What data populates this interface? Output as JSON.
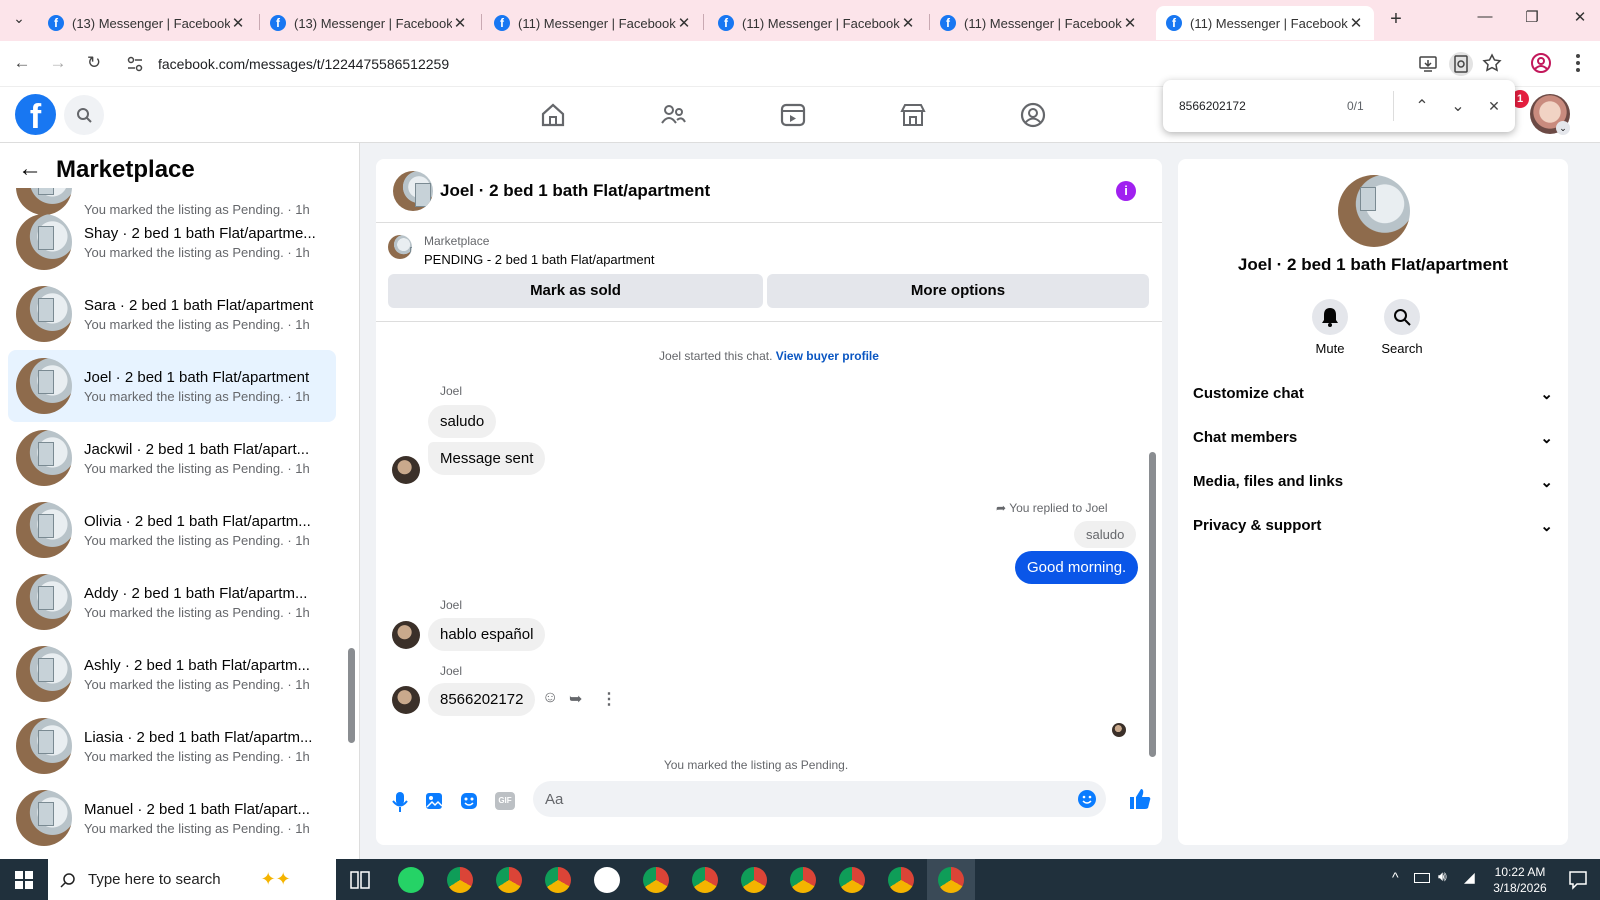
{
  "browser": {
    "tabs": [
      {
        "title": "(13) Messenger | Facebook",
        "close": "✕"
      },
      {
        "title": "(13) Messenger | Facebook",
        "close": "✕"
      },
      {
        "title": "(11) Messenger | Facebook",
        "close": "✕"
      },
      {
        "title": "(11) Messenger | Facebook",
        "close": "✕"
      },
      {
        "title": "(11) Messenger | Facebook",
        "close": "✕"
      },
      {
        "title": "(11) Messenger | Facebook",
        "close": "✕"
      }
    ],
    "favicon": "f",
    "new_tab": "+",
    "tab_menu": "⌄",
    "url": "facebook.com/messages/t/1224475586512259",
    "window": {
      "minimize": "—",
      "restore": "❐",
      "close": "✕"
    },
    "nav": {
      "back": "←",
      "forward": "→",
      "reload": "↻"
    },
    "find": {
      "query": "8566202172",
      "count": "0/1",
      "up": "⌃",
      "down": "⌄",
      "close": "✕"
    },
    "accent": "#1877f2",
    "tab_bg": "#fce4ea"
  },
  "fb_header": {
    "logo": "f",
    "notification_badge": "1",
    "icons": [
      "home-icon",
      "friends-icon",
      "video-icon",
      "marketplace-icon",
      "gaming-icon",
      "search-icon"
    ]
  },
  "sidebar": {
    "back": "←",
    "title": "Marketplace",
    "partial_item_sub": "You marked the listing as Pending. · 1h",
    "items": [
      {
        "title": "Shay · 2 bed 1 bath Flat/apartme...",
        "sub": "You marked the listing as Pending. · 1h"
      },
      {
        "title": "Sara · 2 bed 1 bath Flat/apartment",
        "sub": "You marked the listing as Pending. · 1h"
      },
      {
        "title": "Joel · 2 bed 1 bath Flat/apartment",
        "sub": "You marked the listing as Pending. · 1h"
      },
      {
        "title": "Jackwil · 2 bed 1 bath Flat/apart...",
        "sub": "You marked the listing as Pending. · 1h"
      },
      {
        "title": "Olivia · 2 bed 1 bath Flat/apartm...",
        "sub": "You marked the listing as Pending. · 1h"
      },
      {
        "title": "Addy · 2 bed 1 bath Flat/apartm...",
        "sub": "You marked the listing as Pending. · 1h"
      },
      {
        "title": "Ashly · 2 bed 1 bath Flat/apartm...",
        "sub": "You marked the listing as Pending. · 1h"
      },
      {
        "title": "Liasia · 2 bed 1 bath Flat/apartm...",
        "sub": "You marked the listing as Pending. · 1h"
      },
      {
        "title": "Manuel · 2 bed 1 bath Flat/apart...",
        "sub": "You marked the listing as Pending. · 1h"
      }
    ]
  },
  "conversation": {
    "title": "Joel · 2 bed 1 bath Flat/apartment",
    "listing_source": "Marketplace",
    "listing_status": "PENDING - 2 bed 1 bath Flat/apartment",
    "mark_sold": "Mark as sold",
    "more_options": "More options",
    "started": "Joel started this chat.",
    "view_profile": "View buyer profile",
    "sender": "Joel",
    "msg1": "saludo",
    "msg2": "Message sent",
    "replied_to": "You replied to Joel",
    "quoted": "saludo",
    "my_reply": "Good morning.",
    "msg3": "hablo español",
    "msg4": "8566202172",
    "footer_note": "You marked the listing as Pending.",
    "composer_placeholder": "Aa",
    "gif": "GIF",
    "outgoing_color": "#0a56e8"
  },
  "details": {
    "title": "Joel · 2 bed 1 bath Flat/apartment",
    "mute": "Mute",
    "search": "Search",
    "sections": [
      "Customize chat",
      "Chat members",
      "Media, files and links",
      "Privacy & support"
    ]
  },
  "taskbar": {
    "search_placeholder": "Type here to search",
    "time": "10:22 AM",
    "date": "3/18/2026"
  }
}
